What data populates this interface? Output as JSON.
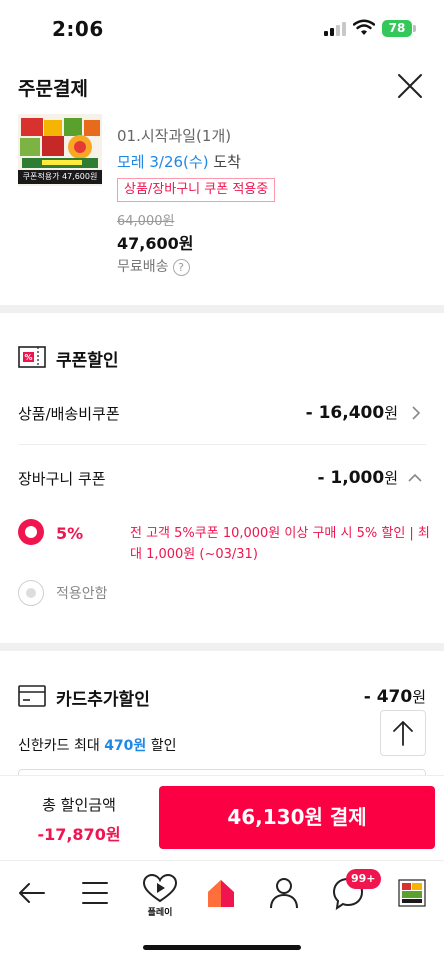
{
  "status": {
    "time": "2:06",
    "battery": "78"
  },
  "header": {
    "title": "주문결제"
  },
  "product": {
    "thumb_caption": "쿠폰적용가 47,600원",
    "option": "01.시작과일(1개)",
    "delivery_date": "모레 3/26(수)",
    "delivery_suffix": "도착",
    "coupon_badge": "상품/장바구니 쿠폰 적용중",
    "original_price": "64,000원",
    "sale_price": "47,600원",
    "shipping": "무료배송",
    "help_glyph": "?"
  },
  "coupon": {
    "title": "쿠폰할인",
    "product_shipping_label": "상품/배송비쿠폰",
    "product_shipping_value": "- 16,400",
    "cart_label": "장바구니 쿠폰",
    "cart_value": "- 1,000",
    "unit": "원",
    "options": [
      {
        "percent": "5%",
        "description": "전 고객 5%쿠폰 10,000원 이상 구매 시 5% 할인 | 최대 1,000원 (~03/31)"
      },
      {
        "label": "적용안함"
      }
    ]
  },
  "card": {
    "title": "카드추가할인",
    "value": "- 470",
    "unit": "원",
    "desc_prefix": "신한카드 최대",
    "desc_amount": "470원",
    "desc_suffix": "할인"
  },
  "bottom": {
    "total_label": "총 할인금액",
    "total_value": "-17,870원",
    "pay_label": "46,130원 결제"
  },
  "nav": {
    "play_label": "플레이",
    "chat_badge": "99+"
  },
  "colors": {
    "accent": "#f0154f",
    "pay_button": "#fb0042",
    "blue": "#1e88e5"
  }
}
